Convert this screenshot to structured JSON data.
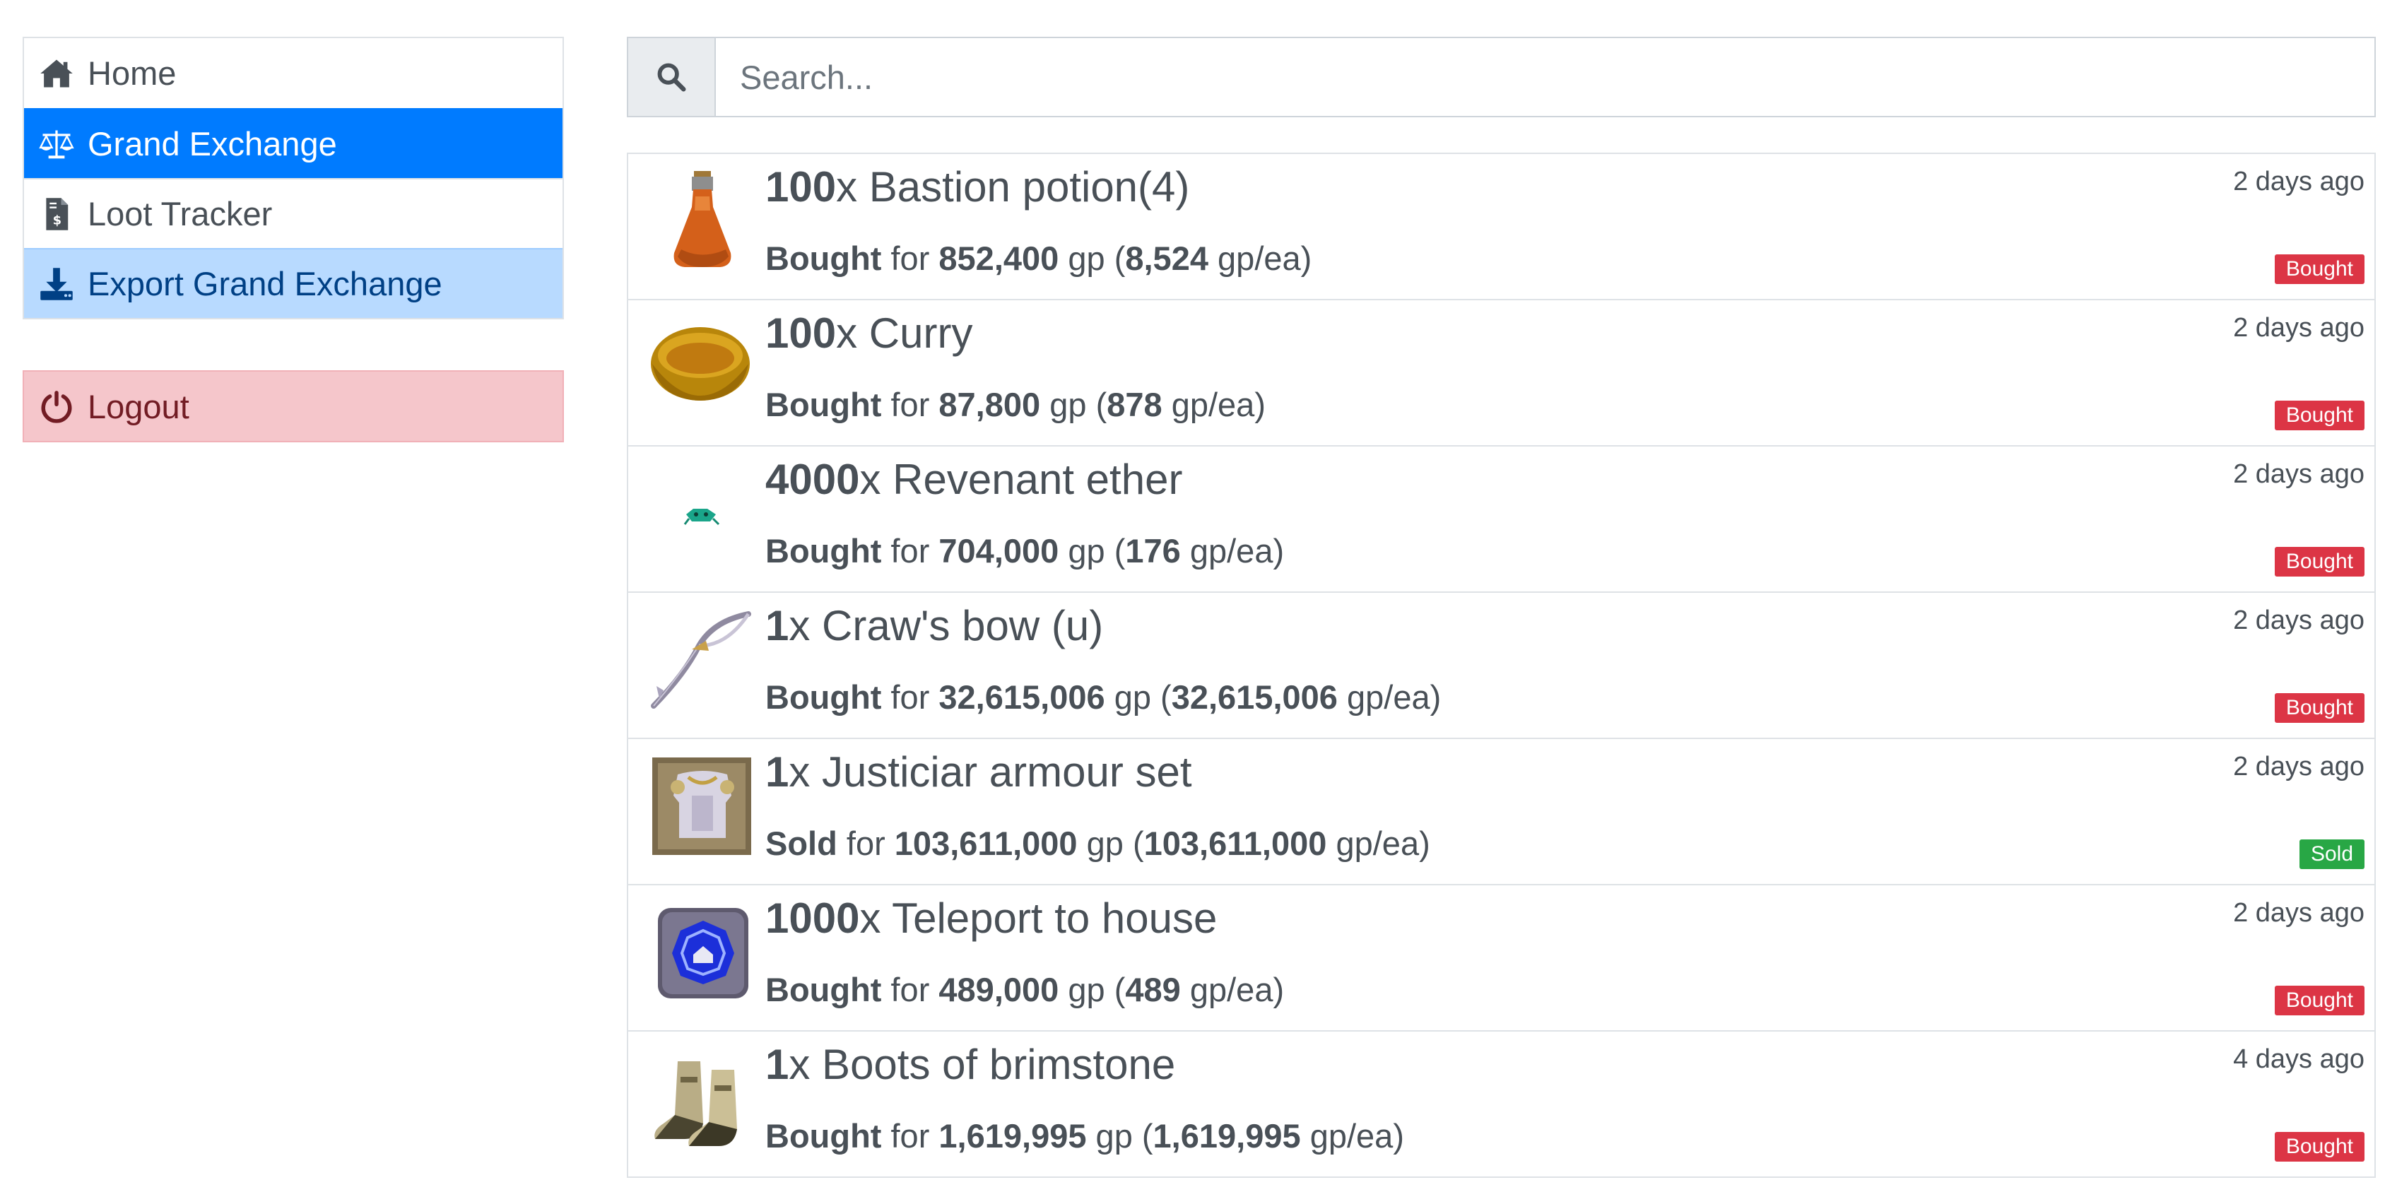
{
  "sidebar": {
    "items": [
      {
        "label": "Home",
        "icon": "home-icon",
        "state": "default"
      },
      {
        "label": "Grand Exchange",
        "icon": "balance-scale-icon",
        "state": "active"
      },
      {
        "label": "Loot Tracker",
        "icon": "file-invoice-dollar-icon",
        "state": "default"
      },
      {
        "label": "Export Grand Exchange",
        "icon": "download-icon",
        "state": "export"
      }
    ],
    "logout_label": "Logout",
    "logout_icon": "power-off-icon"
  },
  "search": {
    "placeholder": "Search...",
    "value": "",
    "icon": "search-icon"
  },
  "colors": {
    "active": "#007bff",
    "export": "#b8daff",
    "logout": "#f5c6cb",
    "bought": "#dc3545",
    "sold": "#28a745"
  },
  "transactions": [
    {
      "quantity": "100",
      "item": "Bastion potion(4)",
      "action": "Bought",
      "total": "852,400",
      "each": "8,524",
      "time": "2 days ago",
      "status": "Bought",
      "icon": "bastion-potion-icon"
    },
    {
      "quantity": "100",
      "item": "Curry",
      "action": "Bought",
      "total": "87,800",
      "each": "878",
      "time": "2 days ago",
      "status": "Bought",
      "icon": "curry-bowl-icon"
    },
    {
      "quantity": "4000",
      "item": "Revenant ether",
      "action": "Bought",
      "total": "704,000",
      "each": "176",
      "time": "2 days ago",
      "status": "Bought",
      "icon": "revenant-ether-icon"
    },
    {
      "quantity": "1",
      "item": "Craw's bow (u)",
      "action": "Bought",
      "total": "32,615,006",
      "each": "32,615,006",
      "time": "2 days ago",
      "status": "Bought",
      "icon": "craws-bow-icon"
    },
    {
      "quantity": "1",
      "item": "Justiciar armour set",
      "action": "Sold",
      "total": "103,611,000",
      "each": "103,611,000",
      "time": "2 days ago",
      "status": "Sold",
      "icon": "justiciar-armour-set-icon"
    },
    {
      "quantity": "1000",
      "item": "Teleport to house",
      "action": "Bought",
      "total": "489,000",
      "each": "489",
      "time": "2 days ago",
      "status": "Bought",
      "icon": "teleport-tablet-icon"
    },
    {
      "quantity": "1",
      "item": "Boots of brimstone",
      "action": "Bought",
      "total": "1,619,995",
      "each": "1,619,995",
      "time": "4 days ago",
      "status": "Bought",
      "icon": "boots-of-brimstone-icon"
    }
  ],
  "text": {
    "for": " for ",
    "gp_open": " gp (",
    "gp_ea": " gp/ea)",
    "x": "x "
  }
}
